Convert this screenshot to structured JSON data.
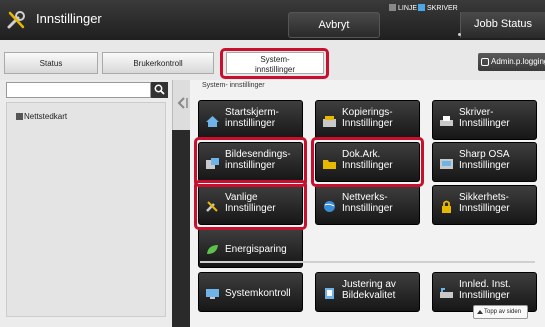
{
  "header": {
    "title": "Innstillinger",
    "cancel_label": "Avbryt",
    "indicator_line": "LINJE",
    "indicator_printer": "SKRIVER",
    "job_status_label": "Jobb Status"
  },
  "tabs": {
    "status": "Status",
    "user_control": "Brukerkontroll",
    "system": "System-\ninnstillinger"
  },
  "admin": {
    "label": "Admin.p.logging"
  },
  "sidebar": {
    "search_placeholder": "",
    "item_label": "Nettstedkart"
  },
  "main": {
    "breadcrumb": "System- innstillinger",
    "buttons": [
      {
        "label": "Startskjerm-\ninnstillinger",
        "icon": "home-icon"
      },
      {
        "label": "Kopierings-\nInnstillinger",
        "icon": "copier-icon"
      },
      {
        "label": "Skriver-\nInnstillinger",
        "icon": "printer-icon"
      },
      {
        "label": "Bildesendings-\ninnstillinger",
        "icon": "image-send-icon"
      },
      {
        "label": "Dok.Ark.\nInnstillinger",
        "icon": "folder-icon"
      },
      {
        "label": "Sharp OSA\nInnstillinger",
        "icon": "osa-icon"
      },
      {
        "label": "Vanlige\nInnstillinger",
        "icon": "tools-icon"
      },
      {
        "label": "Nettverks-\nInnstillinger",
        "icon": "globe-icon"
      },
      {
        "label": "Sikkerhets-\nInnstillinger",
        "icon": "lock-icon"
      },
      {
        "label": "Energisparing",
        "icon": "leaf-icon"
      },
      {
        "label": "Systemkontroll",
        "icon": "monitor-icon"
      },
      {
        "label": "Justering av\nBildekvalitet",
        "icon": "image-quality-icon"
      },
      {
        "label": "Innled. Inst.\nInnstillinger",
        "icon": "initial-setup-icon"
      }
    ],
    "top_of_page": "Topp av siden"
  },
  "colors": {
    "highlight": "#c8102e",
    "line_indicator": "#3a6fd8",
    "printer_indicator": "#4aa8e8"
  }
}
